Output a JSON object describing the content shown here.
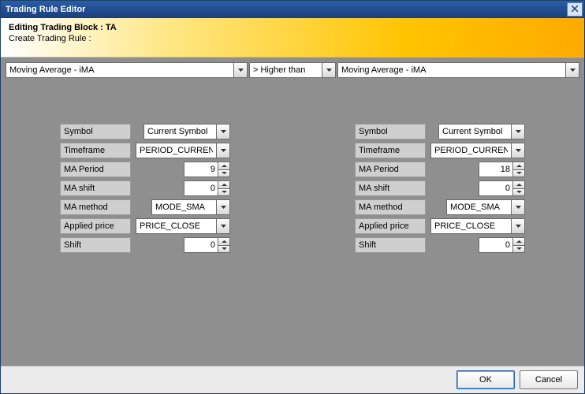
{
  "title": "Trading Rule Editor",
  "banner": {
    "heading": "Editing Trading Block : TA",
    "sub": "Create Trading Rule :"
  },
  "toprow": {
    "left": "Moving Average - iMA",
    "op": "> Higher than",
    "right": "Moving Average - iMA"
  },
  "labels": {
    "symbol": "Symbol",
    "timeframe": "Timeframe",
    "ma_period": "MA Period",
    "ma_shift": "MA shift",
    "ma_method": "MA method",
    "applied_price": "Applied price",
    "shift": "Shift"
  },
  "left": {
    "symbol": "Current Symbol",
    "timeframe": "PERIOD_CURRENT",
    "ma_period": "9",
    "ma_shift": "0",
    "ma_method": "MODE_SMA",
    "applied_price": "PRICE_CLOSE",
    "shift": "0"
  },
  "right": {
    "symbol": "Current Symbol",
    "timeframe": "PERIOD_CURRENT",
    "ma_period": "18",
    "ma_shift": "0",
    "ma_method": "MODE_SMA",
    "applied_price": "PRICE_CLOSE",
    "shift": "0"
  },
  "footer": {
    "ok": "OK",
    "cancel": "Cancel"
  }
}
